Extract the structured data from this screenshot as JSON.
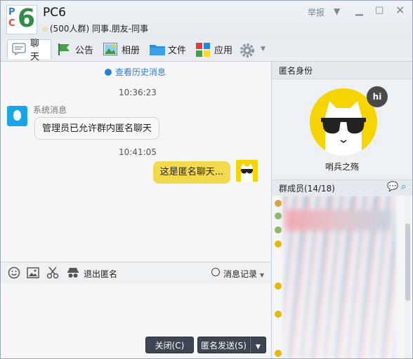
{
  "header": {
    "title": "PC6",
    "subtitle": "(500人群) 同事.朋友-同事",
    "logo": {
      "line1": "P",
      "line2": "C",
      "digit": "6"
    },
    "report": "举报"
  },
  "tabs": [
    {
      "label": "聊天",
      "icon": "chat-icon"
    },
    {
      "label": "公告",
      "icon": "flag-icon"
    },
    {
      "label": "相册",
      "icon": "photo-icon"
    },
    {
      "label": "文件",
      "icon": "folder-icon"
    },
    {
      "label": "应用",
      "icon": "apps-icon"
    }
  ],
  "chat": {
    "history_link": "查看历史消息",
    "messages": [
      {
        "time": "10:36:23",
        "sender": "系统消息",
        "text": "管理员已允许群内匿名聊天"
      },
      {
        "time": "10:41:05",
        "text": "这是匿名聊天..."
      }
    ]
  },
  "input_toolbar": {
    "exit_anon": "退出匿名",
    "msg_record": "消息记录"
  },
  "buttons": {
    "close": "关闭(C)",
    "send": "匿名发送(S)"
  },
  "right": {
    "anon_title": "匿名身份",
    "anon_badge": "hi",
    "anon_name": "哨兵之殇",
    "members_title": "群成员(14/18)"
  },
  "colors": {
    "accent": "#2b7fd0",
    "bubble_self": "#f2d94e",
    "button_dark": "#3d4652"
  }
}
